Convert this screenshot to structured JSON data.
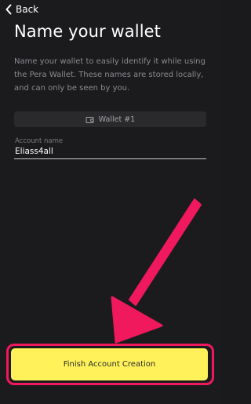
{
  "header": {
    "back_icon": "chevron-left-icon",
    "back_label": "Back"
  },
  "page": {
    "title": "Name your wallet",
    "description": "Name your wallet to easily identify it while using the Pera Wallet. These names are stored locally, and can only be seen by you."
  },
  "wallet_pill": {
    "icon": "wallet-icon",
    "label": "Wallet #1"
  },
  "account_field": {
    "label": "Account name",
    "value": "Eliass4all"
  },
  "finish_button": {
    "label": "Finish Account Creation"
  },
  "colors": {
    "background": "#1b1b1d",
    "button_yellow": "#fff15a",
    "annotation_pink": "#f0195d"
  }
}
